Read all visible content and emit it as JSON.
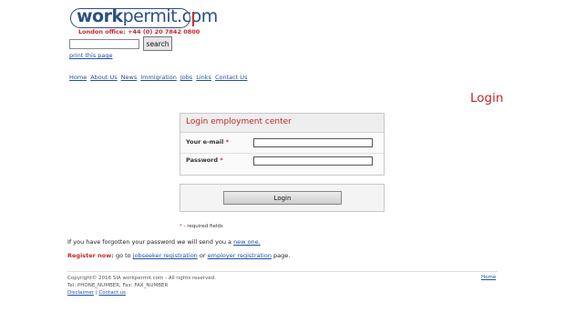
{
  "brand": {
    "logo_bold": "work",
    "logo_rest": "permit.com",
    "office": "London office: +44 (0) 20 7842 0800"
  },
  "search": {
    "button": "search",
    "value": ""
  },
  "print_link": "print this page",
  "nav": [
    "Home",
    "About Us",
    "News",
    "Immigration",
    "Jobs",
    "Links",
    "Contact Us"
  ],
  "page_title": "Login",
  "login": {
    "panel_title": "Login employment center",
    "email_label": "Your e-mail",
    "password_label": "Password",
    "required_mark": "*",
    "email_value": "",
    "password_value": "",
    "submit_label": "Login"
  },
  "required_note": "- required fields",
  "forgot": {
    "text": "If you have forgotten your password we will send you a",
    "link": "new one."
  },
  "register": {
    "lead": "Register now:",
    "go_to": "go to",
    "jobseeker": "jobseeker registration",
    "or": "or",
    "employer": "employer registration",
    "tail": "page."
  },
  "footer": {
    "copyright": "Copyright© 2016 SIA workpermit.com - All rights reserved.",
    "contact": "Tel: PHONE_NUMBER, Fax: FAX_NUMBER",
    "disclaimer": "Disclaimer",
    "separator": "|",
    "contact_us": "Contact us",
    "home": "Home"
  }
}
